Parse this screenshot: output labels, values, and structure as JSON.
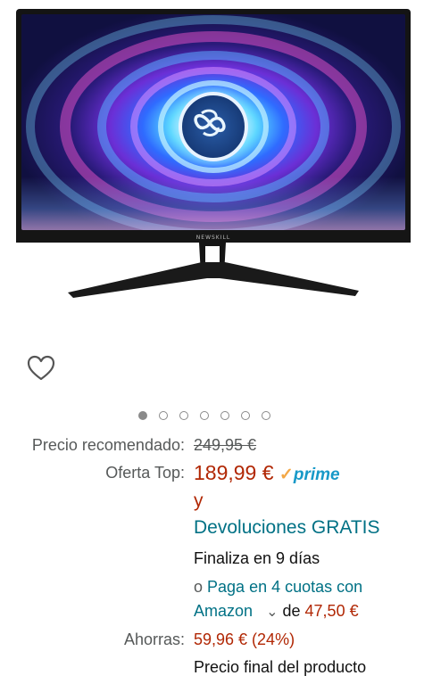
{
  "product_image": {
    "brand_mark": "NEWSKILL"
  },
  "carousel": {
    "count": 7,
    "active_index": 0
  },
  "pricing": {
    "recommended_label": "Precio recomendado:",
    "recommended_price": "249,95 €",
    "offer_label": "Oferta Top:",
    "offer_price": "189,99 €",
    "prime_check": "✓",
    "prime_text": "prime",
    "and_word": "y",
    "returns_link": "Devoluciones GRATIS",
    "ends_text": "Finaliza en 9 días",
    "installments_prefix": "o",
    "installments_link_line1": "Paga en 4 cuotas con",
    "installments_link_line2": "Amazon",
    "installments_chevron": "⌄",
    "installments_of": "de",
    "installments_amount": "47,50 €",
    "savings_label": "Ahorras:",
    "savings_value": "59,96 € (24%)",
    "final_note": "Precio final del producto"
  },
  "colors": {
    "price": "#b12704",
    "link": "#007185",
    "muted": "#565959",
    "prime_blue": "#1799c8",
    "prime_orange": "#f3a847"
  },
  "icons": {
    "wishlist": "heart-outline-icon"
  }
}
